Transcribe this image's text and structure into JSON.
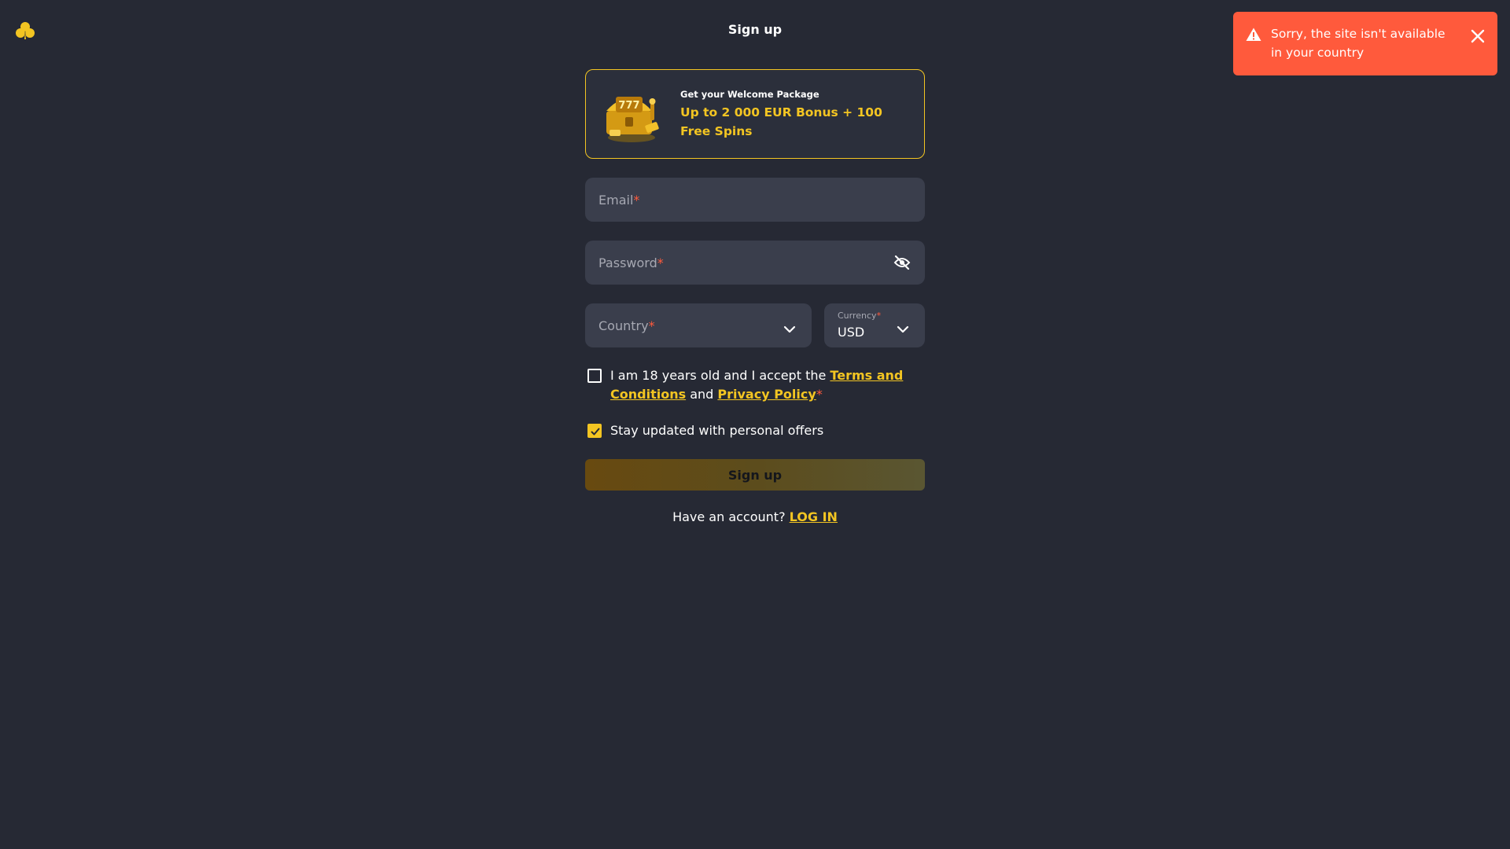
{
  "header": {
    "title": "Sign up",
    "logo_icon": "clover-icon"
  },
  "toast": {
    "message": "Sorry, the site isn't available in your country",
    "icon": "warning-icon",
    "close_icon": "close-icon",
    "color": "#ff5a3c"
  },
  "promo": {
    "small": "Get your Welcome Package",
    "big": "Up to 2 000 EUR Bonus + 100 Free Spins",
    "image": "treasure-chest-icon"
  },
  "form": {
    "email_label": "Email",
    "password_label": "Password",
    "required_mark": "*",
    "country_label": "Country",
    "currency_label": "Currency",
    "currency_value": "USD",
    "terms_prefix": "I am 18 years old and I accept the ",
    "terms_link": "Terms and Conditions",
    "terms_and": " and ",
    "privacy_link": "Privacy Policy",
    "terms_checked": false,
    "offers_label": "Stay updated with personal offers",
    "offers_checked": true,
    "submit_label": "Sign up"
  },
  "login": {
    "prompt": "Have an account? ",
    "link": "LOG IN"
  },
  "colors": {
    "background": "#262934",
    "field": "#3a3e4c",
    "accent": "#f3c522",
    "error": "#ff5a3c"
  }
}
